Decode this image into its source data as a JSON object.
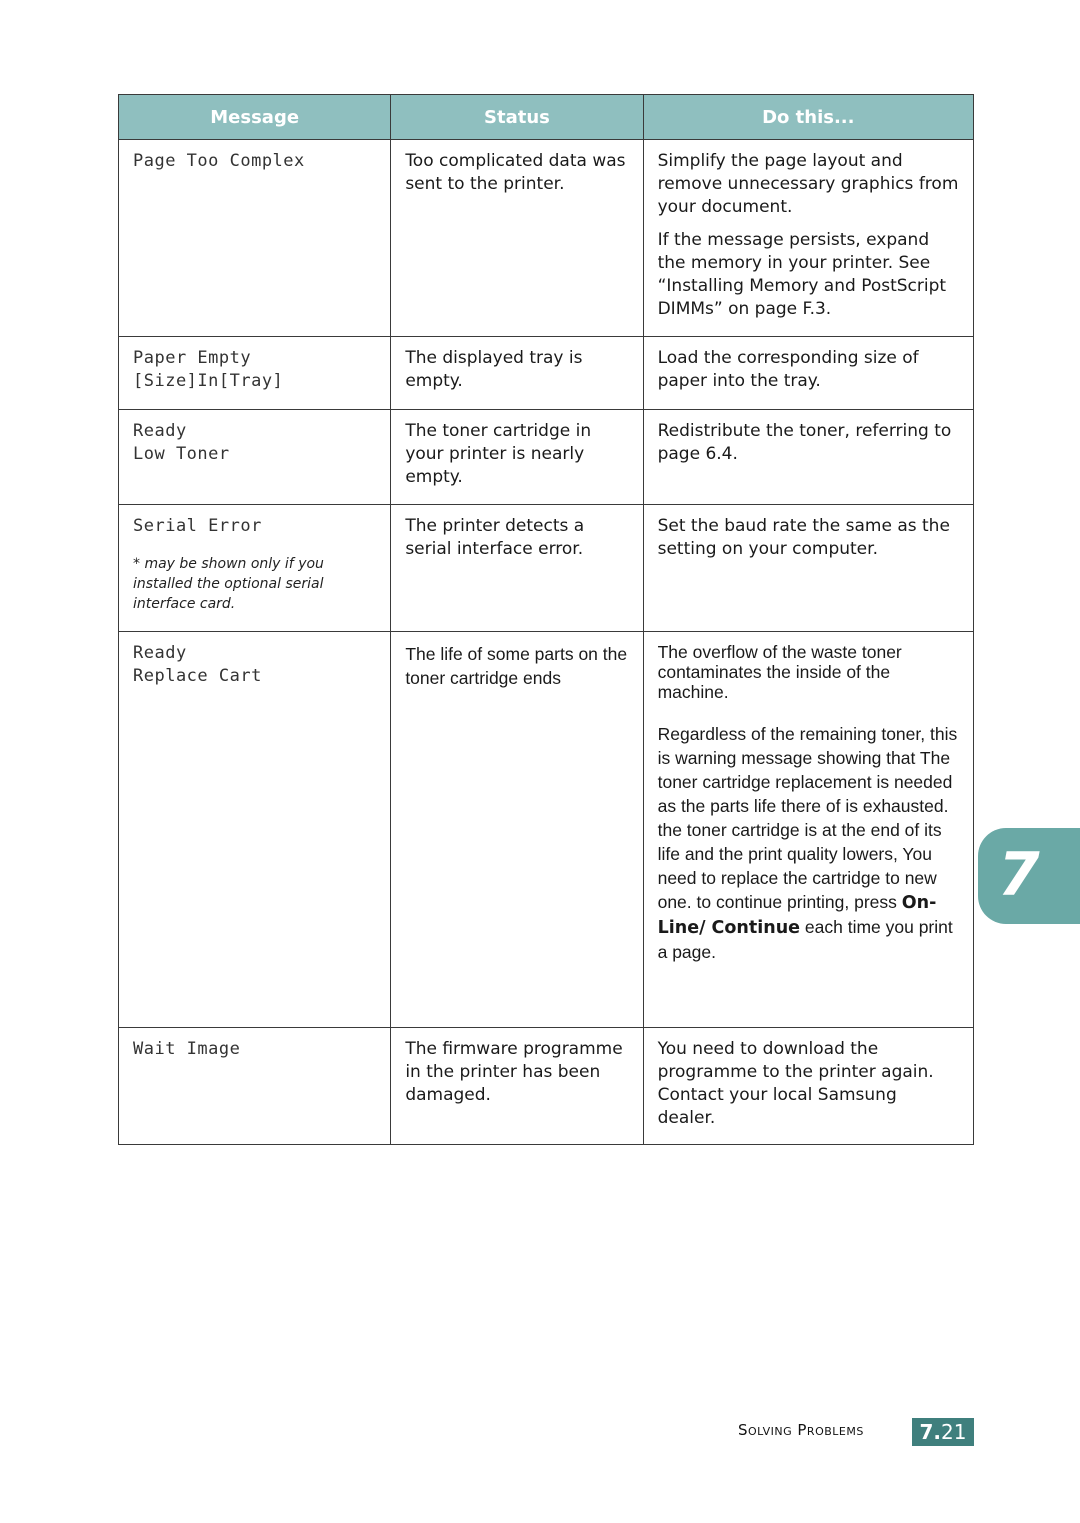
{
  "table": {
    "headers": [
      "Message",
      "Status",
      "Do this..."
    ],
    "rows": [
      {
        "message": "Page Too Complex",
        "status": "Too complicated data was sent to the printer.",
        "do": [
          "Simplify the page layout and remove unnecessary graphics from your document.",
          "If the message persists, expand the memory in your printer. See “Installing Memory and PostScript DIMMs” on page F.3."
        ]
      },
      {
        "message": "Paper Empty\n[Size]In[Tray]",
        "status": "The displayed tray is empty.",
        "do": [
          "Load the corresponding size of paper into the tray."
        ]
      },
      {
        "message": "Ready\nLow Toner",
        "status": "The toner cartridge in your printer is nearly empty.",
        "do": [
          "Redistribute the toner, referring to page 6.4."
        ]
      },
      {
        "message": "Serial Error",
        "note": "* may be shown only if you installed the optional serial interface card.",
        "status": "The printer detects a serial interface error.",
        "do": [
          "Set the baud rate the same as the setting on your computer."
        ]
      },
      {
        "message": "Ready\nReplace Cart",
        "status": "The life of some parts on the toner cartridge ends",
        "do": [
          "The overflow of the waste toner contaminates the inside of the machine.",
          "Regardless of the remaining toner, this is warning message showing that  The toner cartridge replacement is needed as the parts life there of is exhausted. the toner cartridge is at the end of its life and the print quality lowers, You need to replace the cartridge to new one. to continue printing, press"
        ],
        "do_bold_1": "On-Line/ Continue",
        "do_tail": " each time you print a page."
      },
      {
        "message": "Wait Image",
        "status": "The firmware programme in the printer has been damaged.",
        "do": [
          "You need to download the programme to the printer again. Contact your local Samsung dealer."
        ]
      }
    ]
  },
  "chapter_tab": "7",
  "footer": {
    "section": "Solving Problems",
    "page_chapter": "7.",
    "page_number": "21"
  },
  "colors": {
    "header_bg": "#8fbfbf",
    "tab_bg": "#6aa9a6",
    "page_badge_bg": "#3f7f7d"
  }
}
